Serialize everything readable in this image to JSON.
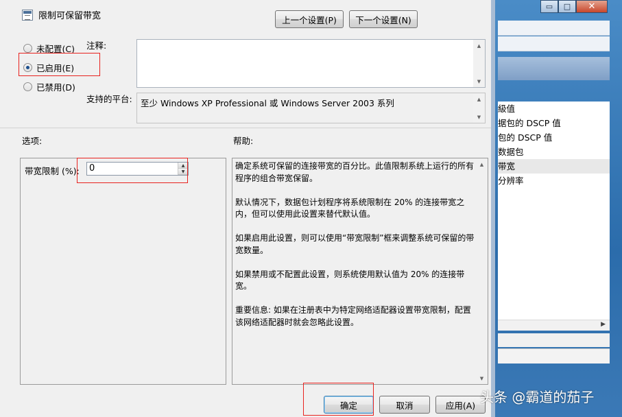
{
  "dialog": {
    "title": "限制可保留带宽",
    "prev_button": "上一个设置(P)",
    "next_button": "下一个设置(N)",
    "radios": [
      {
        "label": "未配置(C)",
        "selected": false
      },
      {
        "label": "已启用(E)",
        "selected": true
      },
      {
        "label": "已禁用(D)",
        "selected": false
      }
    ],
    "comment_label": "注释:",
    "comment_value": "",
    "platform_label": "支持的平台:",
    "platform_value": "至少 Windows XP Professional 或 Windows Server 2003 系列",
    "options_label": "选项:",
    "help_label": "帮助:",
    "bandwidth_label": "带宽限制 (%):",
    "bandwidth_value": "0",
    "help_paragraphs": [
      "确定系统可保留的连接带宽的百分比。此值限制系统上运行的所有程序的组合带宽保留。",
      "默认情况下，数据包计划程序将系统限制在 20% 的连接带宽之内，但可以使用此设置来替代默认值。",
      "如果启用此设置，则可以使用“带宽限制”框来调整系统可保留的带宽数量。",
      "如果禁用或不配置此设置，则系统使用默认值为 20% 的连接带宽。",
      "重要信息: 如果在注册表中为特定网络适配器设置带宽限制，配置该网络适配器时就会忽略此设置。"
    ],
    "ok_button": "确定",
    "cancel_button": "取消",
    "apply_button": "应用(A)"
  },
  "background_window": {
    "caption_buttons": [
      "▭",
      "□",
      "✕"
    ],
    "list_items": [
      "級值",
      "据包的 DSCP 值",
      "包的 DSCP 值",
      "数据包",
      "带宽",
      "分辨率"
    ],
    "selected_index": 4
  },
  "watermark": "头条 @霸道的茄子",
  "icons": {
    "title_icon": "policy-setting-icon",
    "scroll_up": "▲",
    "scroll_down": "▼",
    "scroll_right": "▶"
  },
  "colors": {
    "annotation_red": "#e8211d",
    "dialog_bg": "#f0f0f0",
    "window_frame_blue": "#2f74b8"
  }
}
